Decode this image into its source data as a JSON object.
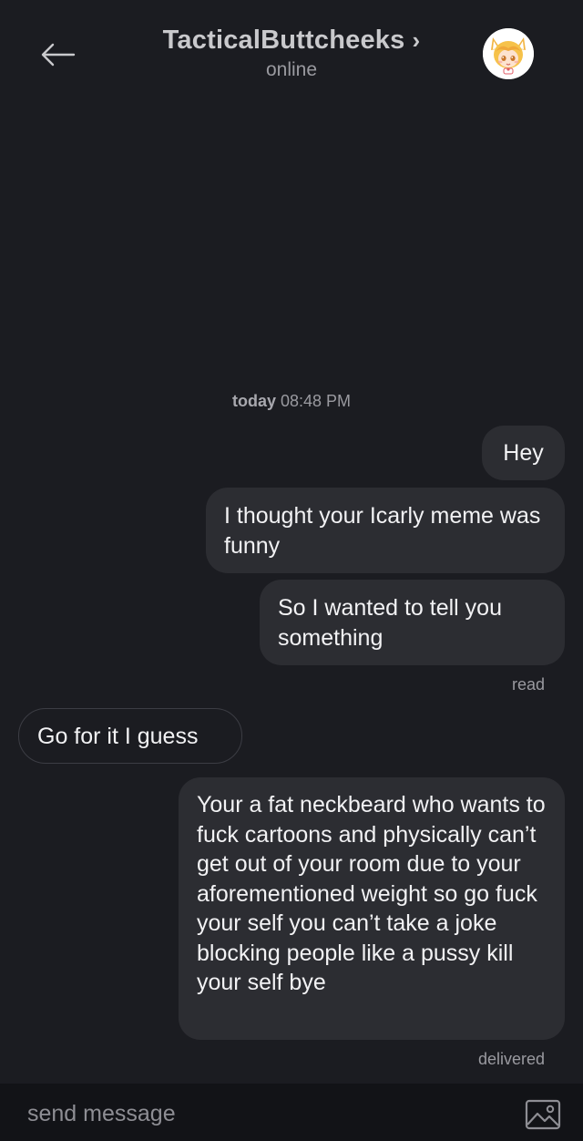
{
  "header": {
    "back_icon": "arrow-left-icon",
    "contact_name": "TacticalButtcheeks",
    "chevron": "›",
    "status": "online",
    "avatar_icon": "anime-fox-girl-avatar"
  },
  "conversation": {
    "timestamp_day": "today",
    "timestamp_time": "08:48 PM",
    "messages": [
      {
        "direction": "outgoing",
        "text": "Hey"
      },
      {
        "direction": "outgoing",
        "text": "I thought your Icarly meme was funny"
      },
      {
        "direction": "outgoing",
        "text": "So I wanted to tell you something"
      },
      {
        "direction": "incoming",
        "text": "Go for it I guess"
      },
      {
        "direction": "outgoing",
        "text": "Your a fat neckbeard who wants to fuck cartoons and physically can’t get out of your room due to your aforementioned weight so go fuck your self you can’t take a joke blocking people like a pussy kill your self bye"
      }
    ],
    "read_receipt": "read",
    "delivered_receipt": "delivered"
  },
  "composer": {
    "placeholder": "send message",
    "image_icon": "image-icon"
  },
  "colors": {
    "background": "#1b1c21",
    "outgoing_bubble": "#2c2d32",
    "incoming_border": "#3c3d44",
    "composer_bar": "#121317",
    "muted_text": "#9a9aa0"
  }
}
